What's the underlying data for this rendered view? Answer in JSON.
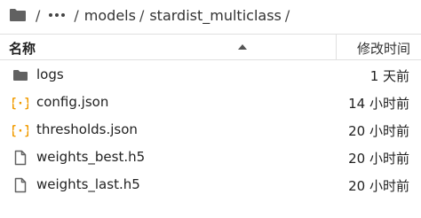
{
  "breadcrumb": {
    "items": [
      "models",
      "stardist_multiclass"
    ],
    "separator": "/"
  },
  "header": {
    "name_label": "名称",
    "modified_label": "修改时间"
  },
  "files": [
    {
      "name": "logs",
      "modified": "1 天前",
      "icon": "folder-icon"
    },
    {
      "name": "config.json",
      "modified": "14 小时前",
      "icon": "json-icon"
    },
    {
      "name": "thresholds.json",
      "modified": "20 小时前",
      "icon": "json-icon"
    },
    {
      "name": "weights_best.h5",
      "modified": "20 小时前",
      "icon": "file-icon"
    },
    {
      "name": "weights_last.h5",
      "modified": "20 小时前",
      "icon": "file-icon"
    }
  ],
  "colors": {
    "json_icon": "#f19b00",
    "folder_icon": "#616161",
    "file_icon": "#616161"
  }
}
